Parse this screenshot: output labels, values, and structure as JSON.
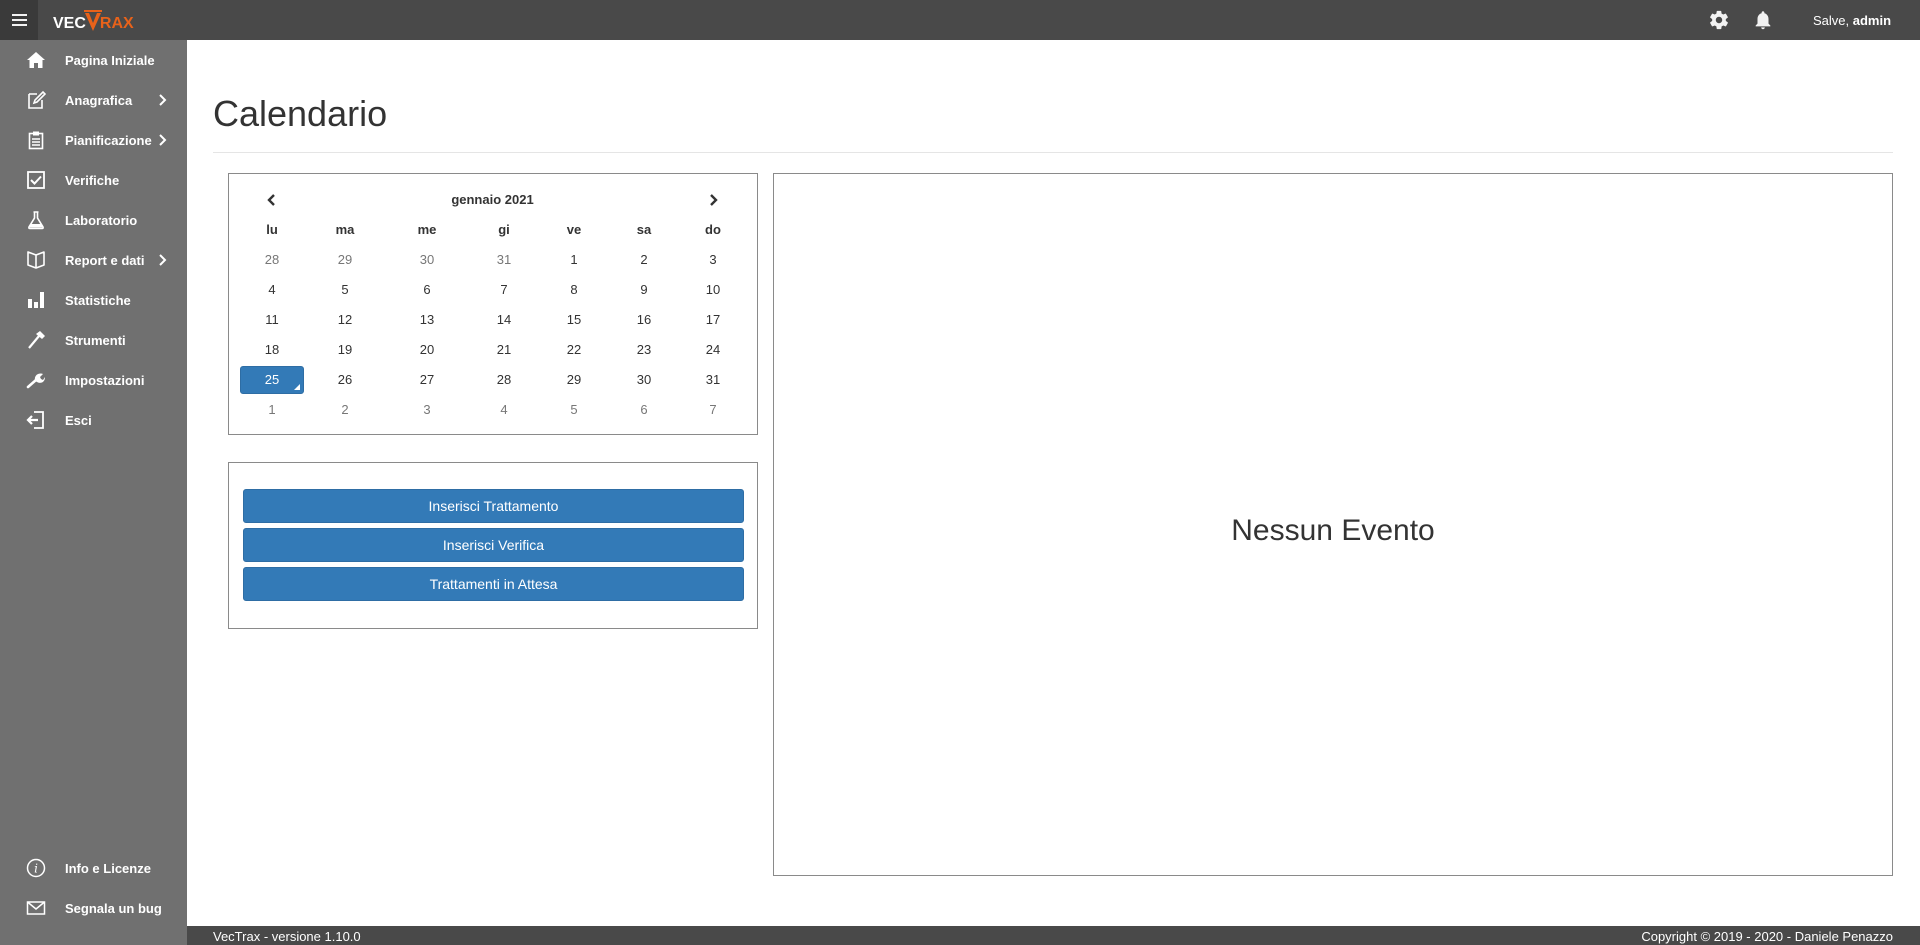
{
  "app": {
    "logo_left": "VEC",
    "logo_right": "RAX",
    "brand_color": "#e8621a",
    "greeting_prefix": "Salve, ",
    "greeting_user": "admin",
    "icons": [
      "menu-icon",
      "settings-gear-icon",
      "bell-icon"
    ]
  },
  "sidebar": {
    "items": [
      {
        "label": "Pagina Iniziale",
        "icon": "home-icon",
        "submenu": false
      },
      {
        "label": "Anagrafica",
        "icon": "edit-note-icon",
        "submenu": true
      },
      {
        "label": "Pianificazione",
        "icon": "clipboard-icon",
        "submenu": true
      },
      {
        "label": "Verifiche",
        "icon": "checkbox-icon",
        "submenu": false
      },
      {
        "label": "Laboratorio",
        "icon": "flask-icon",
        "submenu": false
      },
      {
        "label": "Report e dati",
        "icon": "book-icon",
        "submenu": true
      },
      {
        "label": "Statistiche",
        "icon": "bar-chart-icon",
        "submenu": false
      },
      {
        "label": "Strumenti",
        "icon": "hammer-icon",
        "submenu": false
      },
      {
        "label": "Impostazioni",
        "icon": "wrench-icon",
        "submenu": false
      },
      {
        "label": "Esci",
        "icon": "logout-icon",
        "submenu": false
      }
    ],
    "bottom_items": [
      {
        "label": "Info e Licenze",
        "icon": "info-icon"
      },
      {
        "label": "Segnala un bug",
        "icon": "mail-icon"
      }
    ]
  },
  "main": {
    "title": "Calendario",
    "calendar": {
      "month_label": "gennaio 2021",
      "weekdays": [
        "lu",
        "ma",
        "me",
        "gi",
        "ve",
        "sa",
        "do"
      ],
      "weeks": [
        [
          {
            "d": "28",
            "other": true
          },
          {
            "d": "29",
            "other": true
          },
          {
            "d": "30",
            "other": true
          },
          {
            "d": "31",
            "other": true
          },
          {
            "d": "1"
          },
          {
            "d": "2"
          },
          {
            "d": "3"
          }
        ],
        [
          {
            "d": "4"
          },
          {
            "d": "5"
          },
          {
            "d": "6"
          },
          {
            "d": "7"
          },
          {
            "d": "8"
          },
          {
            "d": "9"
          },
          {
            "d": "10"
          }
        ],
        [
          {
            "d": "11"
          },
          {
            "d": "12"
          },
          {
            "d": "13"
          },
          {
            "d": "14"
          },
          {
            "d": "15"
          },
          {
            "d": "16"
          },
          {
            "d": "17"
          }
        ],
        [
          {
            "d": "18"
          },
          {
            "d": "19"
          },
          {
            "d": "20"
          },
          {
            "d": "21"
          },
          {
            "d": "22"
          },
          {
            "d": "23"
          },
          {
            "d": "24"
          }
        ],
        [
          {
            "d": "25",
            "selected": true
          },
          {
            "d": "26"
          },
          {
            "d": "27"
          },
          {
            "d": "28"
          },
          {
            "d": "29"
          },
          {
            "d": "30"
          },
          {
            "d": "31"
          }
        ],
        [
          {
            "d": "1",
            "other": true
          },
          {
            "d": "2",
            "other": true
          },
          {
            "d": "3",
            "other": true
          },
          {
            "d": "4",
            "other": true
          },
          {
            "d": "5",
            "other": true
          },
          {
            "d": "6",
            "other": true
          },
          {
            "d": "7",
            "other": true
          }
        ]
      ]
    },
    "actions": {
      "insert_treatment": "Inserisci Trattamento",
      "insert_check": "Inserisci Verifica",
      "pending_treatments": "Trattamenti in Attesa",
      "button_color": "#337ab7"
    },
    "events": {
      "empty_label": "Nessun Evento"
    }
  },
  "footer": {
    "version": "VecTrax - versione 1.10.0",
    "copyright": "Copyright © 2019 - 2020 - Daniele Penazzo"
  }
}
